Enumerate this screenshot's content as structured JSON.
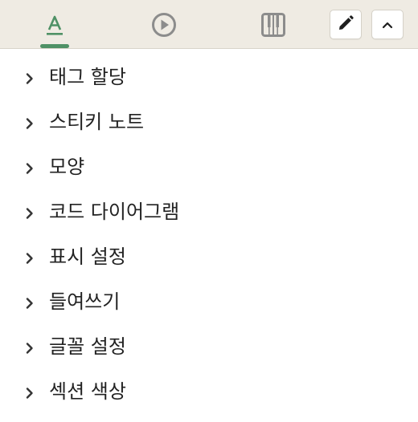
{
  "toolbar": {
    "tabs": [
      {
        "icon": "text-format-icon",
        "active": true
      },
      {
        "icon": "play-circle-icon",
        "active": false
      },
      {
        "icon": "piano-keys-icon",
        "active": false
      }
    ],
    "buttons": [
      {
        "icon": "pencil-icon"
      },
      {
        "icon": "chevron-up-icon"
      }
    ],
    "accent_color": "#4f9166"
  },
  "sections": [
    {
      "label": "태그 할당"
    },
    {
      "label": "스티키 노트"
    },
    {
      "label": "모양"
    },
    {
      "label": "코드 다이어그램"
    },
    {
      "label": "표시 설정"
    },
    {
      "label": "들여쓰기"
    },
    {
      "label": "글꼴 설정"
    },
    {
      "label": "섹션 색상"
    }
  ]
}
